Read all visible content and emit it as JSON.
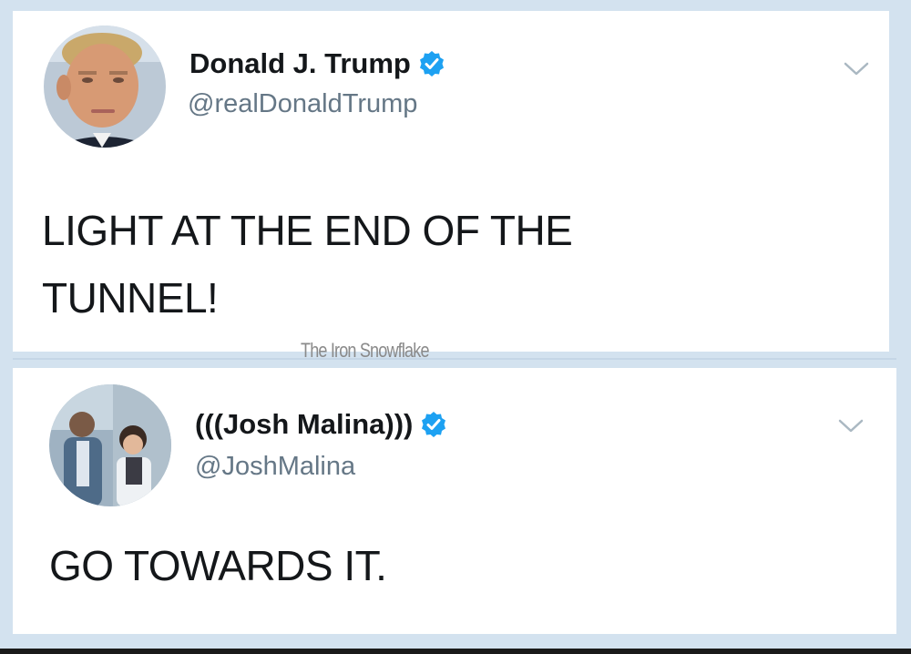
{
  "tweets": [
    {
      "display_name": "Donald J. Trump",
      "handle": "@realDonaldTrump",
      "text_line_1": "LIGHT AT THE END OF THE",
      "text_line_2": "TUNNEL!",
      "verified": true,
      "avatar_icon": "portrait-photo"
    },
    {
      "display_name": "(((Josh Malina)))",
      "handle": "@JoshMalina",
      "text_line_1": "GO TOWARDS IT.",
      "verified": true,
      "avatar_icon": "family-photo"
    }
  ],
  "watermark": "The Iron Snowflake",
  "colors": {
    "background": "#d3e2ef",
    "card": "#ffffff",
    "verified_badge": "#1da1f2",
    "handle_text": "#657786",
    "primary_text": "#14171a"
  }
}
